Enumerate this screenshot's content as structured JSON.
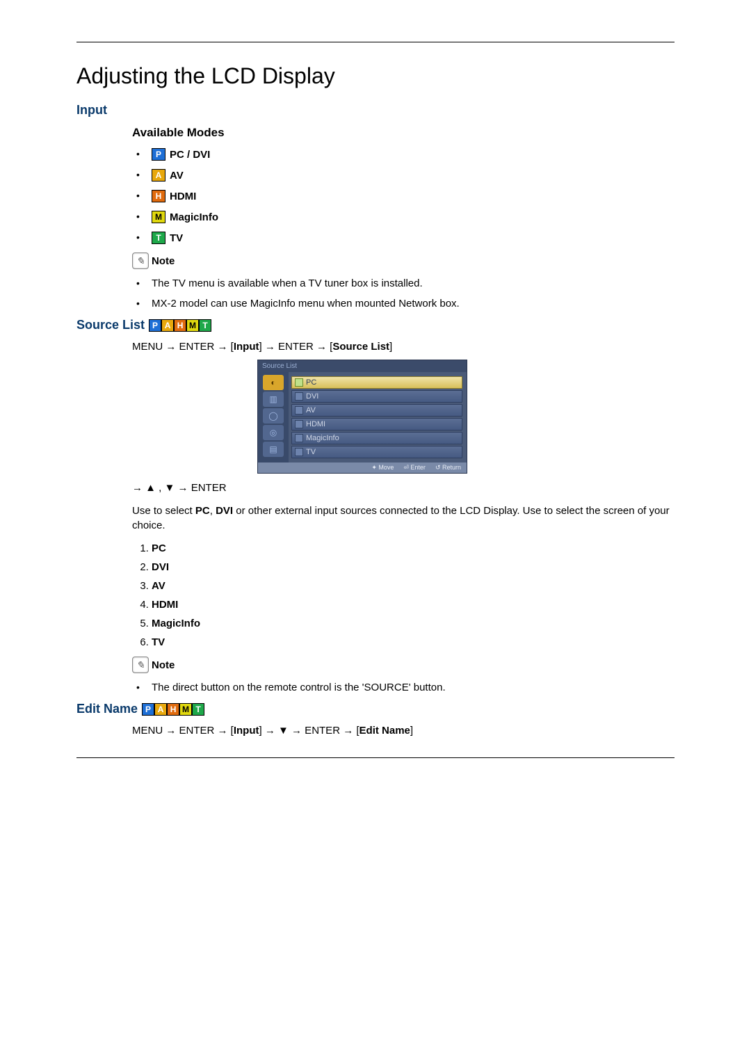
{
  "title": "Adjusting the LCD Display",
  "section_input": "Input",
  "available_modes_heading": "Available Modes",
  "modes": {
    "p": {
      "letter": "P",
      "label": "PC / DVI"
    },
    "a": {
      "letter": "A",
      "label": "AV"
    },
    "h": {
      "letter": "H",
      "label": "HDMI"
    },
    "m": {
      "letter": "M",
      "label": "MagicInfo"
    },
    "t": {
      "letter": "T",
      "label": "TV"
    }
  },
  "note_label": "Note",
  "note1_items": [
    "The TV menu is available when a TV tuner box is installed.",
    "MX-2 model can use MagicInfo menu when mounted Network box."
  ],
  "source_list_heading": "Source List",
  "nav_source_list": "MENU → ENTER → [Input] → ENTER → [Source List]",
  "osd": {
    "title": "Source List",
    "items": [
      "PC",
      "DVI",
      "AV",
      "HDMI",
      "MagicInfo",
      "TV"
    ],
    "footer": {
      "move": "Move",
      "enter": "Enter",
      "return": "Return"
    }
  },
  "nav_arrows": "→ ▲ , ▼ → ENTER",
  "source_desc_pre": "Use to select ",
  "source_desc_pc": "PC",
  "source_desc_sep": ", ",
  "source_desc_dvi": "DVI",
  "source_desc_post": " or other external input sources connected to the LCD Display. Use to select the screen of your choice.",
  "source_options": [
    "PC",
    "DVI",
    "AV",
    "HDMI",
    "MagicInfo",
    "TV"
  ],
  "note2_items": [
    "The direct button on the remote control is the 'SOURCE' button."
  ],
  "edit_name_heading": "Edit Name",
  "nav_edit_name": "MENU → ENTER → [Input] → ▼ → ENTER → [Edit Name]"
}
